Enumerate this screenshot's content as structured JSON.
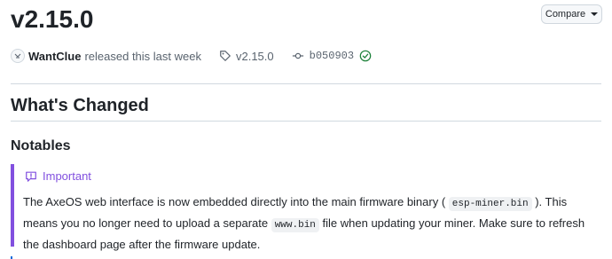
{
  "release": {
    "title": "v2.15.0",
    "compare_label": "Compare",
    "author": "WantClue",
    "released_text": "released this last week",
    "tag": "v2.15.0",
    "commit": "b050903"
  },
  "content": {
    "heading": "What's Changed",
    "subheading": "Notables",
    "alert": {
      "title": "Important",
      "text_1": "The AxeOS web interface is now embedded directly into the main firmware binary ( ",
      "code_1": "esp-miner.bin",
      "text_2": " ). This means you no longer need to upload a separate ",
      "code_2": "www.bin",
      "text_3": " file when updating your miner. Make sure to refresh the dashboard page after the firmware update."
    }
  },
  "colors": {
    "important_accent": "#8250df",
    "verified_green": "#1a7f37"
  }
}
